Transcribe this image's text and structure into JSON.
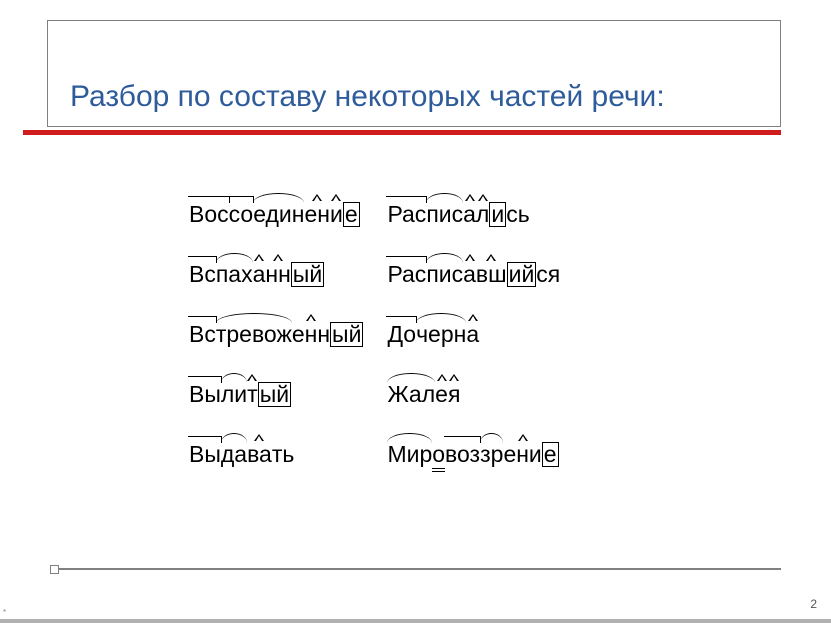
{
  "title": "Разбор по составу некоторых частей речи:",
  "page_number": "2",
  "columns": [
    {
      "words": [
        {
          "parts": [
            {
              "t": "Вос",
              "m": "prefix"
            },
            {
              "t": "со",
              "m": "prefix"
            },
            {
              "t": "един",
              "m": "root"
            },
            {
              "t": "ен",
              "m": "suffix"
            },
            {
              "t": "и",
              "m": "suffix"
            },
            {
              "t": "е",
              "m": "ending"
            }
          ]
        },
        {
          "parts": [
            {
              "t": "Вс",
              "m": "prefix"
            },
            {
              "t": "пах",
              "m": "root"
            },
            {
              "t": "а",
              "m": "suffix"
            },
            {
              "t": "нн",
              "m": "suffix"
            },
            {
              "t": "ый",
              "m": "ending"
            }
          ]
        },
        {
          "parts": [
            {
              "t": "Вс",
              "m": "prefix"
            },
            {
              "t": "тревож",
              "m": "root"
            },
            {
              "t": "енн",
              "m": "suffix"
            },
            {
              "t": "ый",
              "m": "ending"
            }
          ]
        },
        {
          "parts": [
            {
              "t": "Вы",
              "m": "prefix"
            },
            {
              "t": "ли",
              "m": "root"
            },
            {
              "t": "т",
              "m": "suffix"
            },
            {
              "t": "ый",
              "m": "ending"
            }
          ]
        },
        {
          "parts": [
            {
              "t": "Вы",
              "m": "prefix"
            },
            {
              "t": "да",
              "m": "root"
            },
            {
              "t": "ва",
              "m": "suffix"
            },
            {
              "t": "ть",
              "m": ""
            }
          ]
        }
      ]
    },
    {
      "words": [
        {
          "parts": [
            {
              "t": "Рас",
              "m": "prefix"
            },
            {
              "t": "пис",
              "m": "root"
            },
            {
              "t": "а",
              "m": "suffix"
            },
            {
              "t": "л",
              "m": "suffix"
            },
            {
              "t": "и",
              "m": "ending"
            },
            {
              "t": "сь",
              "m": ""
            }
          ]
        },
        {
          "parts": [
            {
              "t": "Рас",
              "m": "prefix"
            },
            {
              "t": "пис",
              "m": "root"
            },
            {
              "t": "а",
              "m": "suffix"
            },
            {
              "t": "вш",
              "m": "suffix"
            },
            {
              "t": "ий",
              "m": "ending"
            },
            {
              "t": "ся",
              "m": ""
            }
          ]
        },
        {
          "parts": [
            {
              "t": "До",
              "m": "prefix"
            },
            {
              "t": "черн",
              "m": "root"
            },
            {
              "t": "а",
              "m": "suffix"
            }
          ]
        },
        {
          "parts": [
            {
              "t": "Жал",
              "m": "root"
            },
            {
              "t": "е",
              "m": "suffix"
            },
            {
              "t": "я",
              "m": "suffix"
            }
          ]
        },
        {
          "parts": [
            {
              "t": "Мир",
              "m": "root"
            },
            {
              "t": "о",
              "m": "connect"
            },
            {
              "t": "воз",
              "m": "prefix"
            },
            {
              "t": "зр",
              "m": "root"
            },
            {
              "t": "ени",
              "m": "suffix"
            },
            {
              "t": "е",
              "m": "ending"
            }
          ]
        }
      ]
    }
  ]
}
